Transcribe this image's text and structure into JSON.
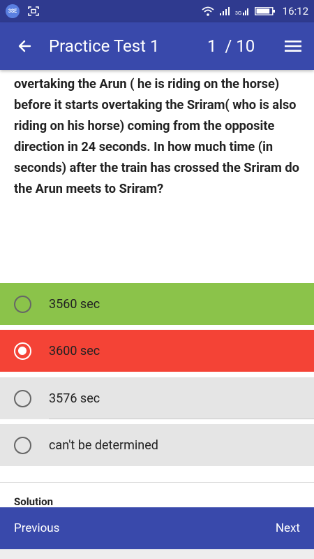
{
  "status_bar": {
    "time": "16:12",
    "badge_text": "3SE",
    "battery_level": 0.85,
    "icons": [
      "app-badge-icon",
      "screenshot-icon",
      "wifi-icon",
      "signal-icon",
      "signal-3g-icon",
      "battery-icon"
    ]
  },
  "app_bar": {
    "title": "Practice Test 1",
    "progress": "1  / 10",
    "back_icon": "arrow-left-icon",
    "menu_icon": "hamburger-menu-icon"
  },
  "question": {
    "text": "travels for half an hour from the time it starts overtaking the Arun ( he is riding on the horse) before it starts overtaking the Sriram( who is also riding on his horse) coming from the opposite direction in 24 seconds. In how much time (in seconds) after the train has crossed the Sriram do the Arun meets to Sriram?"
  },
  "options": [
    {
      "label": "3560 sec",
      "state": "correct",
      "selected": false
    },
    {
      "label": "3600 sec",
      "state": "wrong",
      "selected": true
    },
    {
      "label": "3576 sec",
      "state": "neutral",
      "selected": false
    },
    {
      "label": "can't be determined",
      "state": "neutral",
      "selected": false
    }
  ],
  "solution": {
    "heading": "Solution"
  },
  "navigation": {
    "previous_label": "Previous",
    "next_label": "Next"
  },
  "colors": {
    "status_bar": "#2f3a8f",
    "primary": "#3949ab",
    "correct": "#8bc34a",
    "wrong": "#f44336",
    "neutral_option": "#e5e5e5"
  }
}
